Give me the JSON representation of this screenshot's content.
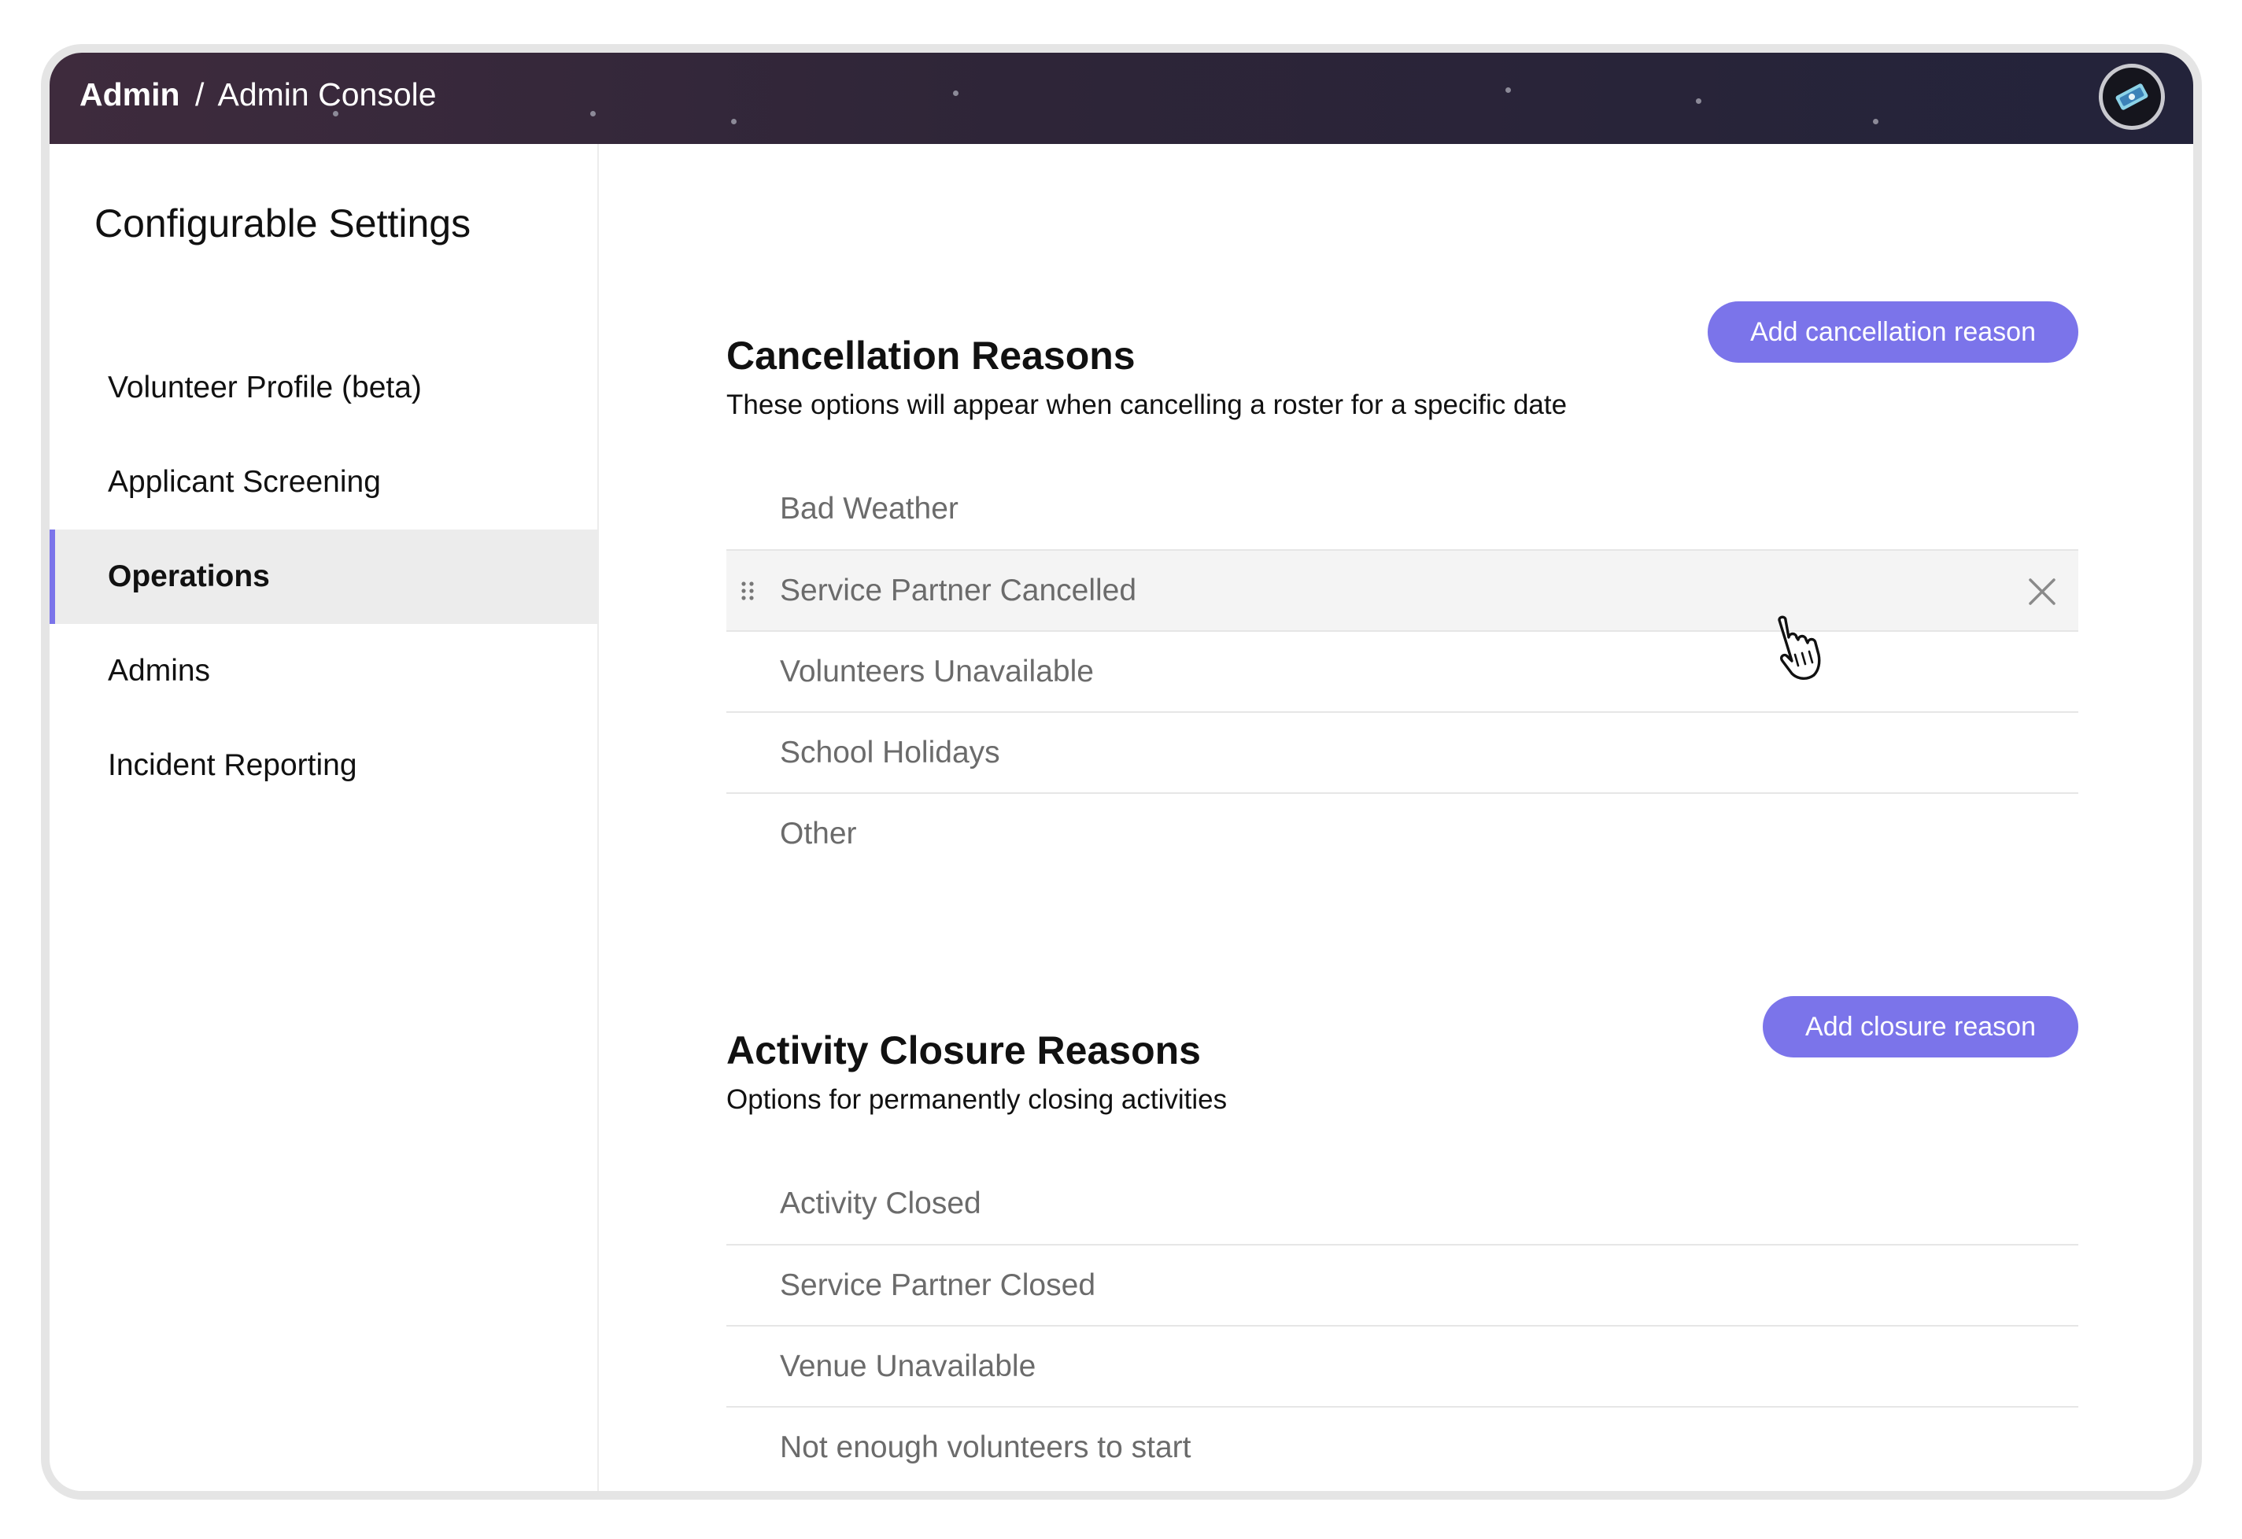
{
  "header": {
    "breadcrumb_root": "Admin",
    "breadcrumb_separator": "/",
    "breadcrumb_current": "Admin Console",
    "avatar_icon": "avatar-icon"
  },
  "sidebar": {
    "title": "Configurable Settings",
    "items": [
      {
        "label": "Volunteer Profile (beta)",
        "active": false
      },
      {
        "label": "Applicant Screening",
        "active": false
      },
      {
        "label": "Operations",
        "active": true
      },
      {
        "label": "Admins",
        "active": false
      },
      {
        "label": "Incident Reporting",
        "active": false
      }
    ]
  },
  "cancellation": {
    "title": "Cancellation Reasons",
    "subtitle": "These options will appear when cancelling a roster for a specific date",
    "add_label": "Add cancellation reason",
    "items": [
      "Bad Weather",
      "Service Partner Cancelled",
      "Volunteers Unavailable",
      "School Holidays",
      "Other"
    ],
    "hovered_index": 1
  },
  "closure": {
    "title": "Activity Closure Reasons",
    "subtitle": "Options for permanently closing activities",
    "add_label": "Add closure reason",
    "items": [
      "Activity Closed",
      "Service Partner Closed",
      "Venue Unavailable",
      "Not enough volunteers to start"
    ]
  },
  "icons": {
    "drag": "drag-handle-icon",
    "remove": "close-icon",
    "cursor": "hand-pointer-icon"
  },
  "colors": {
    "accent": "#7b74ea",
    "header_gradient_start": "#3e2b3d",
    "header_gradient_end": "#23233a"
  }
}
